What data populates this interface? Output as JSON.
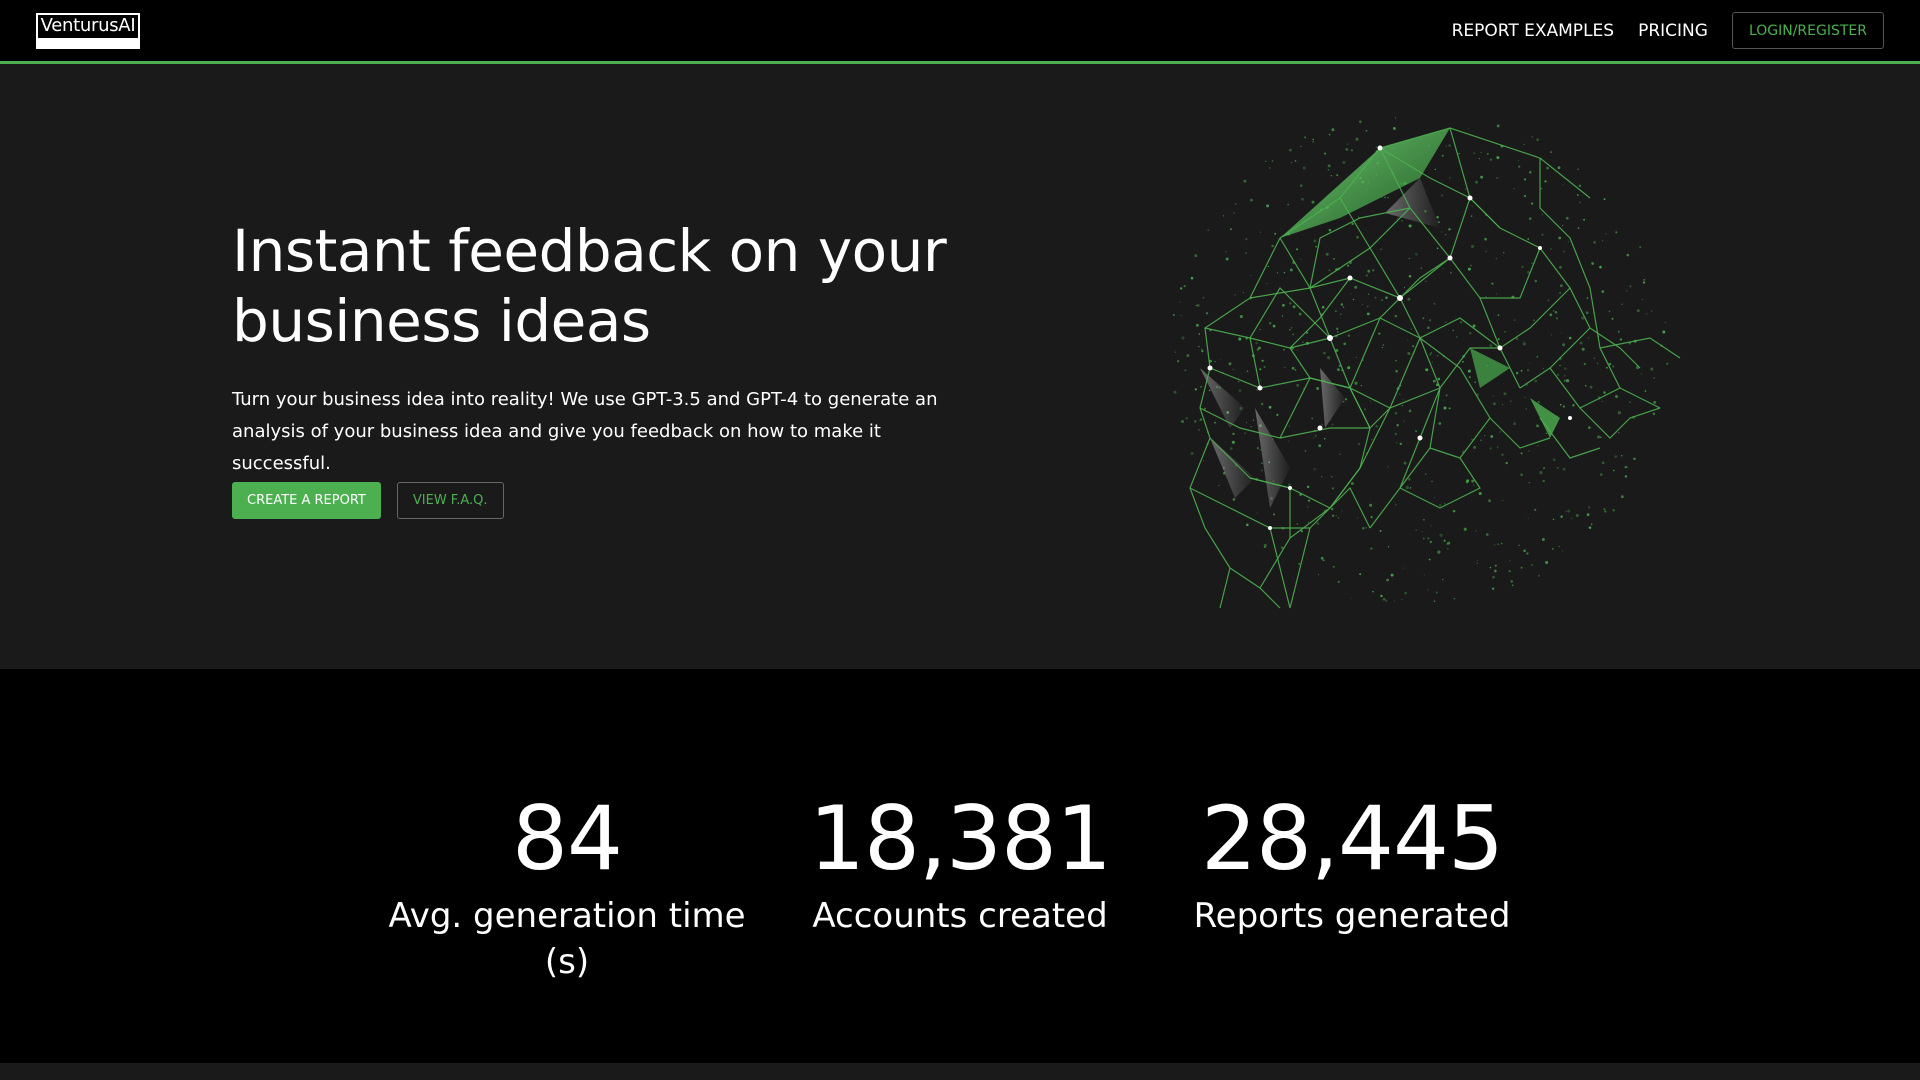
{
  "nav": {
    "logo_text": "VenturusAI",
    "links": [
      "REPORT EXAMPLES",
      "PRICING"
    ],
    "login_label": "LOGIN/REGISTER"
  },
  "hero": {
    "title": "Instant feedback on your business ideas",
    "description": "Turn your business idea into reality! We use GPT-3.5 and GPT-4 to generate an analysis of your business idea and give you feedback on how to make it successful.",
    "primary_button": "CREATE A REPORT",
    "secondary_button": "VIEW F.A.Q.",
    "illustration": "wireframe-head-icon"
  },
  "stats": [
    {
      "value": "84",
      "label": "Avg. generation time (s)"
    },
    {
      "value": "18,381",
      "label": "Accounts created"
    },
    {
      "value": "28,445",
      "label": "Reports generated"
    }
  ],
  "colors": {
    "accent": "#4caf50",
    "background": "#000000",
    "hero_background": "#1a1a1a",
    "text": "#ffffff"
  }
}
